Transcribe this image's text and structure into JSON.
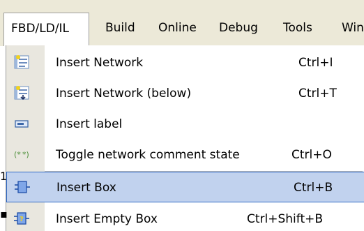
{
  "menubar": {
    "items": [
      {
        "label": "FBD/LD/IL",
        "open": true
      },
      {
        "label": "Build"
      },
      {
        "label": "Online"
      },
      {
        "label": "Debug"
      },
      {
        "label": "Tools"
      },
      {
        "label": "Win"
      }
    ]
  },
  "menu": {
    "items": [
      {
        "label": "Insert Network",
        "shortcut": "Ctrl+I",
        "icon": "insert-network-icon"
      },
      {
        "label": "Insert Network (below)",
        "shortcut": "Ctrl+T",
        "icon": "insert-network-below-icon"
      },
      {
        "label": "Insert label",
        "shortcut": "",
        "icon": "insert-label-icon"
      },
      {
        "label": "Toggle network comment state",
        "shortcut": "Ctrl+O",
        "icon": "comment-toggle-icon"
      },
      {
        "label": "Insert Box",
        "shortcut": "Ctrl+B",
        "icon": "insert-box-icon",
        "highlighted": true
      },
      {
        "label": "Insert Empty Box",
        "shortcut": "Ctrl+Shift+B",
        "icon": "insert-empty-box-icon"
      }
    ]
  },
  "colors": {
    "highlight_bg": "#c1d2ee",
    "highlight_border": "#316ac5",
    "menubar_bg": "#ece9d8",
    "icon_column_bg": "#e9e7df"
  }
}
